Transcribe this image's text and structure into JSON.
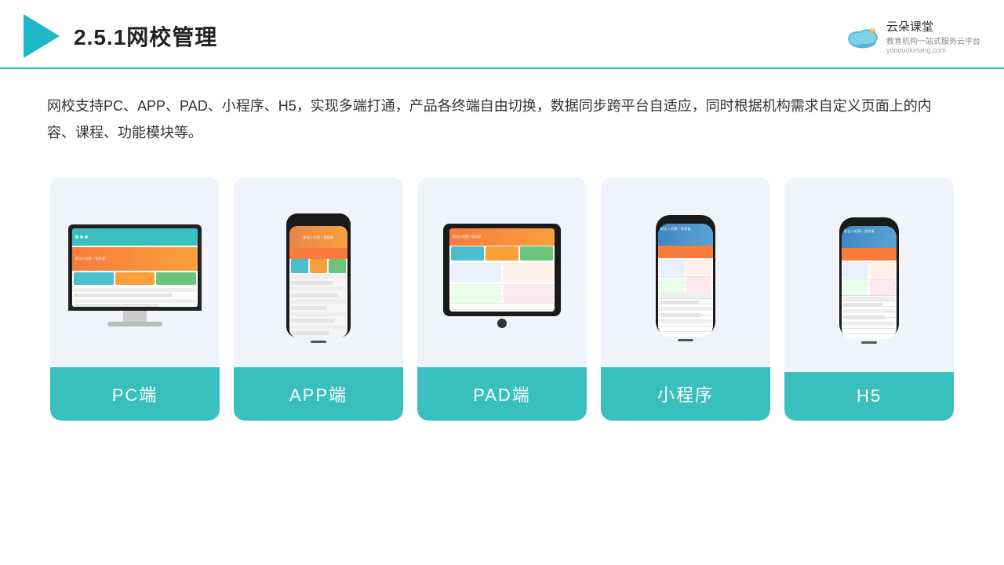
{
  "header": {
    "title": "2.5.1网校管理",
    "logo_alt": "云朵课堂",
    "logo_subtitle": "教育机构一站\n式服务云平台",
    "logo_url": "yunduoketang.com"
  },
  "description": {
    "text": "网校支持PC、APP、PAD、小程序、H5，实现多端打通，产品各终端自由切换，数据同步跨平台自适应，同时根据机构需求自定义页面上的内容、课程、功能模块等。"
  },
  "cards": [
    {
      "id": "pc",
      "label": "PC端"
    },
    {
      "id": "app",
      "label": "APP端"
    },
    {
      "id": "pad",
      "label": "PAD端"
    },
    {
      "id": "mini",
      "label": "小程序"
    },
    {
      "id": "h5",
      "label": "H5"
    }
  ]
}
